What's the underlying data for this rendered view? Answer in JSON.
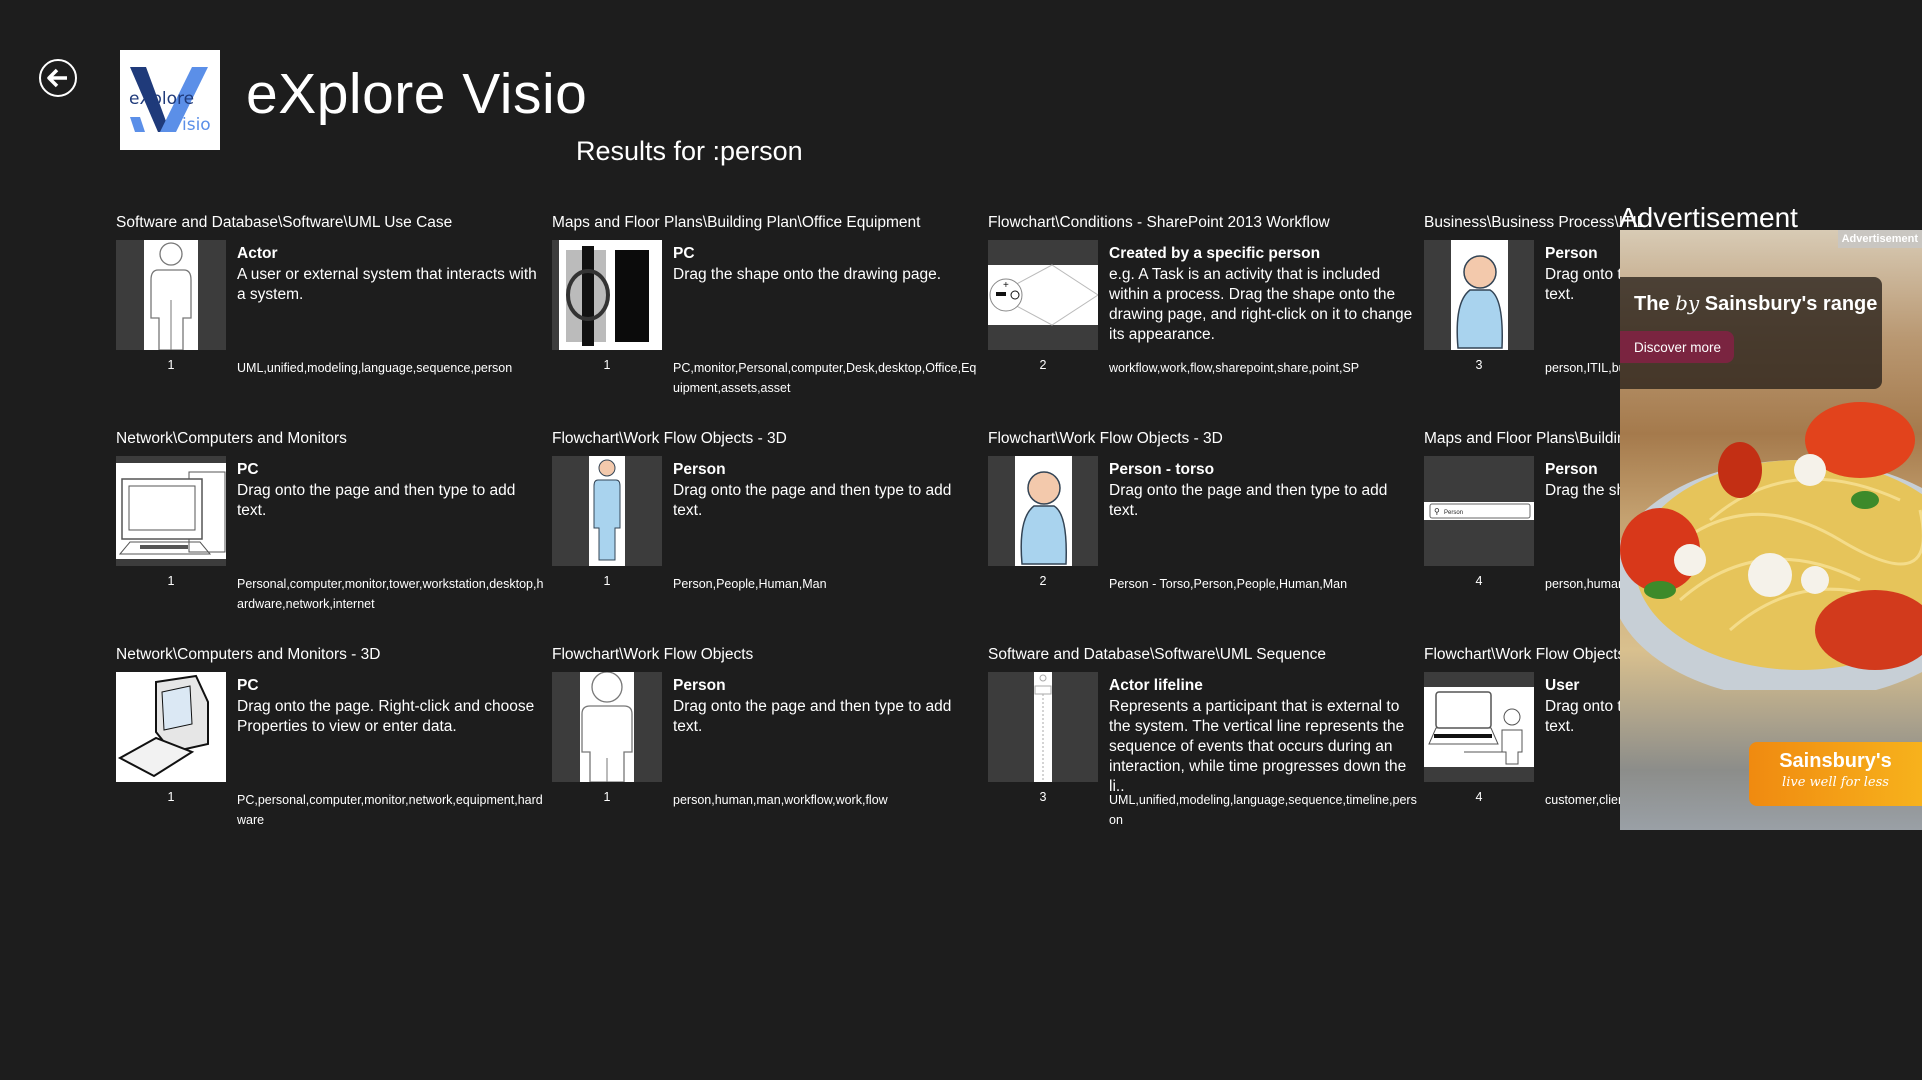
{
  "header": {
    "back_label": "Back",
    "app_title": "eXplore Visio",
    "logo_text_top": "eXplore",
    "logo_text_bottom": "Visio",
    "results_label": "Results for :person"
  },
  "results": [
    {
      "category": "Software and Database\\Software\\UML Use Case",
      "title": "Actor",
      "description": "A user or external system that interacts with a system.",
      "count": "1",
      "tags": "UML,unified,modeling,language,sequence,person",
      "icon": "uml-actor-icon"
    },
    {
      "category": "Maps and Floor Plans\\Building Plan\\Office Equipment",
      "title": "PC",
      "description": "Drag the shape onto the drawing page.",
      "count": "1",
      "tags": "PC,monitor,Personal,computer,Desk,desktop,Office,Equipment,assets,asset",
      "icon": "floorplan-pc-icon"
    },
    {
      "category": "Flowchart\\Conditions - SharePoint 2013 Workflow",
      "title": "Created by a specific person",
      "description": "e.g. A Task is an activity that is included within a process. Drag the shape onto the drawing page, and right-click on it to change its appearance.",
      "count": "2",
      "tags": "workflow,work,flow,sharepoint,share,point,SP",
      "icon": "condition-diamond-icon"
    },
    {
      "category": "Business\\Business Process\\ITIL",
      "title": "Person",
      "description": "Drag onto the page and then type to add text.",
      "count": "3",
      "tags": "person,ITIL,business,structure,library",
      "icon": "person-torso-3d-icon"
    },
    {
      "category": "Network\\Computers and Monitors",
      "title": "PC",
      "description": "Drag onto the page and then type to add text.",
      "count": "1",
      "tags": "Personal,computer,monitor,tower,workstation,desktop,hardware,network,internet",
      "icon": "pc-outline-icon"
    },
    {
      "category": "Flowchart\\Work Flow Objects - 3D",
      "title": "Person",
      "description": "Drag onto the page and then type to add text.",
      "count": "1",
      "tags": "Person,People,Human,Man",
      "icon": "person-full-3d-icon"
    },
    {
      "category": "Flowchart\\Work Flow Objects - 3D",
      "title": "Person - torso",
      "description": "Drag onto the page and then type to add text.",
      "count": "2",
      "tags": "Person - Torso,Person,People,Human,Man",
      "icon": "person-torso-3d-icon"
    },
    {
      "category": "Maps and Floor Plans\\Building Plan",
      "title": "Person",
      "description": "Drag the shape onto the drawing page.",
      "count": "4",
      "tags": "person,human",
      "icon": "person-label-icon",
      "thumb_label": "Person"
    },
    {
      "category": "Network\\Computers and Monitors - 3D",
      "title": "PC",
      "description": "Drag onto the page. Right-click and choose Properties to view or enter data.",
      "count": "1",
      "tags": "PC,personal,computer,monitor,network,equipment,hardware",
      "icon": "pc-3d-icon"
    },
    {
      "category": "Flowchart\\Work Flow Objects",
      "title": "Person",
      "description": "Drag onto the page and then type to add text.",
      "count": "1",
      "tags": "person,human,man,workflow,work,flow",
      "icon": "person-outline-icon"
    },
    {
      "category": "Software and Database\\Software\\UML Sequence",
      "title": "Actor lifeline",
      "description": "Represents a participant that is external to the system. The vertical line represents the sequence of events that occurs during an interaction, while time progresses down the li..",
      "count": "3",
      "tags": "UML,unified,modeling,language,sequence,timeline,person",
      "icon": "actor-lifeline-icon"
    },
    {
      "category": "Flowchart\\Work Flow Objects",
      "title": "User",
      "description": "Drag onto the page and then type to add text.",
      "count": "4",
      "tags": "customer,client,workflow,work",
      "icon": "user-computer-icon"
    }
  ],
  "advertisement": {
    "section_label": "Advertisement",
    "corner_tag": "Advertisement",
    "headline_pre": "The ",
    "headline_italic": "by",
    "headline_post": " Sainsbury's range",
    "cta_label": "Discover more",
    "brand_name": "Sainsbury's",
    "brand_tagline": "live well for less",
    "colors": {
      "cta": "#7a2440",
      "brand": "#f39a14"
    }
  }
}
